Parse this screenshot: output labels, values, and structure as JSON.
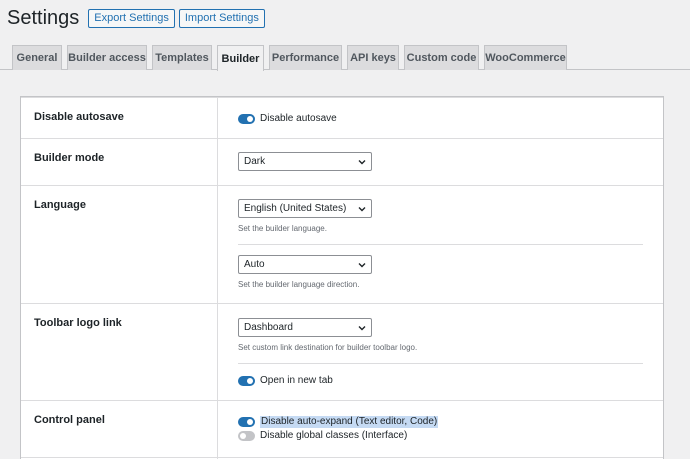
{
  "header": {
    "title": "Settings",
    "export_label": "Export Settings",
    "import_label": "Import Settings"
  },
  "tabs": [
    {
      "label": "General",
      "active": false
    },
    {
      "label": "Builder access",
      "active": false
    },
    {
      "label": "Templates",
      "active": false
    },
    {
      "label": "Builder",
      "active": true
    },
    {
      "label": "Performance",
      "active": false
    },
    {
      "label": "API keys",
      "active": false
    },
    {
      "label": "Custom code",
      "active": false
    },
    {
      "label": "WooCommerce",
      "active": false
    }
  ],
  "rows": {
    "autosave": {
      "label": "Disable autosave",
      "toggle_label": "Disable autosave",
      "toggle_on": true
    },
    "mode": {
      "label": "Builder mode",
      "select_value": "Dark"
    },
    "language": {
      "label": "Language",
      "language_value": "English (United States)",
      "language_desc": "Set the builder language.",
      "direction_value": "Auto",
      "direction_desc": "Set the builder language direction."
    },
    "toolbar": {
      "label": "Toolbar logo link",
      "select_value": "Dashboard",
      "desc": "Set custom link destination for builder toolbar logo.",
      "newtab_label": "Open in new tab",
      "newtab_on": true
    },
    "control": {
      "label": "Control panel",
      "auto_expand_label": "Disable auto-expand (Text editor, Code)",
      "auto_expand_on": true,
      "global_classes_label": "Disable global classes (Interface)",
      "global_classes_on": false
    }
  },
  "colors": {
    "accent": "#2271b1",
    "highlight": "#c5daf3"
  },
  "icons": [
    "chevron-down-icon"
  ]
}
